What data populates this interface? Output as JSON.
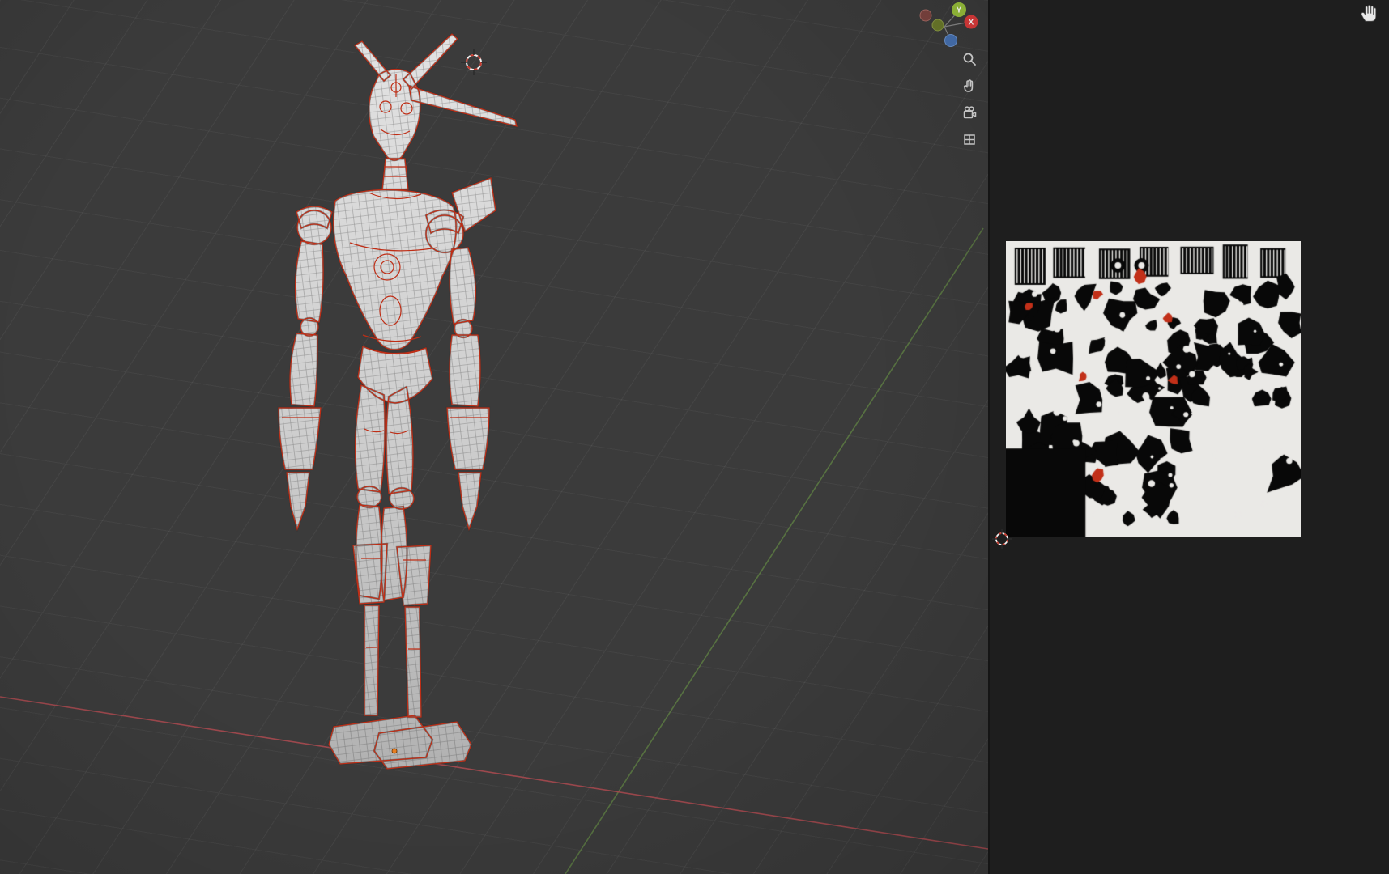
{
  "viewport3d": {
    "background_color": "#3b3b3b",
    "grid_color": "rgba(255,255,255,0.05)",
    "axis_x_color": "#a84a50",
    "axis_y_color": "#5d7c43",
    "gizmo": {
      "y_label": "Y",
      "x_label": "X",
      "x_pos_color": "#dd3b3b",
      "y_pos_color": "#9ac23c",
      "z_pos_color": "#4772b3",
      "x_neg_color": "#7d4440",
      "y_neg_color": "#6b7a2b"
    },
    "nav_buttons": [
      {
        "id": "zoom",
        "icon": "magnifier-icon"
      },
      {
        "id": "pan",
        "icon": "hand-icon"
      },
      {
        "id": "camera-view",
        "icon": "camera-icon"
      },
      {
        "id": "view-toggle",
        "icon": "grid-icon"
      }
    ],
    "model": {
      "surface_color_top": "#e3e3e3",
      "surface_color_bottom": "#b0b0b0",
      "seam_color": "#bf2e16",
      "wire_color": "#3c3c3c",
      "origin_dot_color": "#e77e22"
    }
  },
  "uv_editor": {
    "background_color": "#1e1e1e",
    "image": {
      "background": "#eae9e6",
      "island_color": "#080808",
      "accent_color": "#c23019"
    }
  },
  "cursors": {
    "cursor_3d": "crosshair-circle",
    "cursor_2d": "crosshair-circle",
    "pointer": "hand"
  }
}
